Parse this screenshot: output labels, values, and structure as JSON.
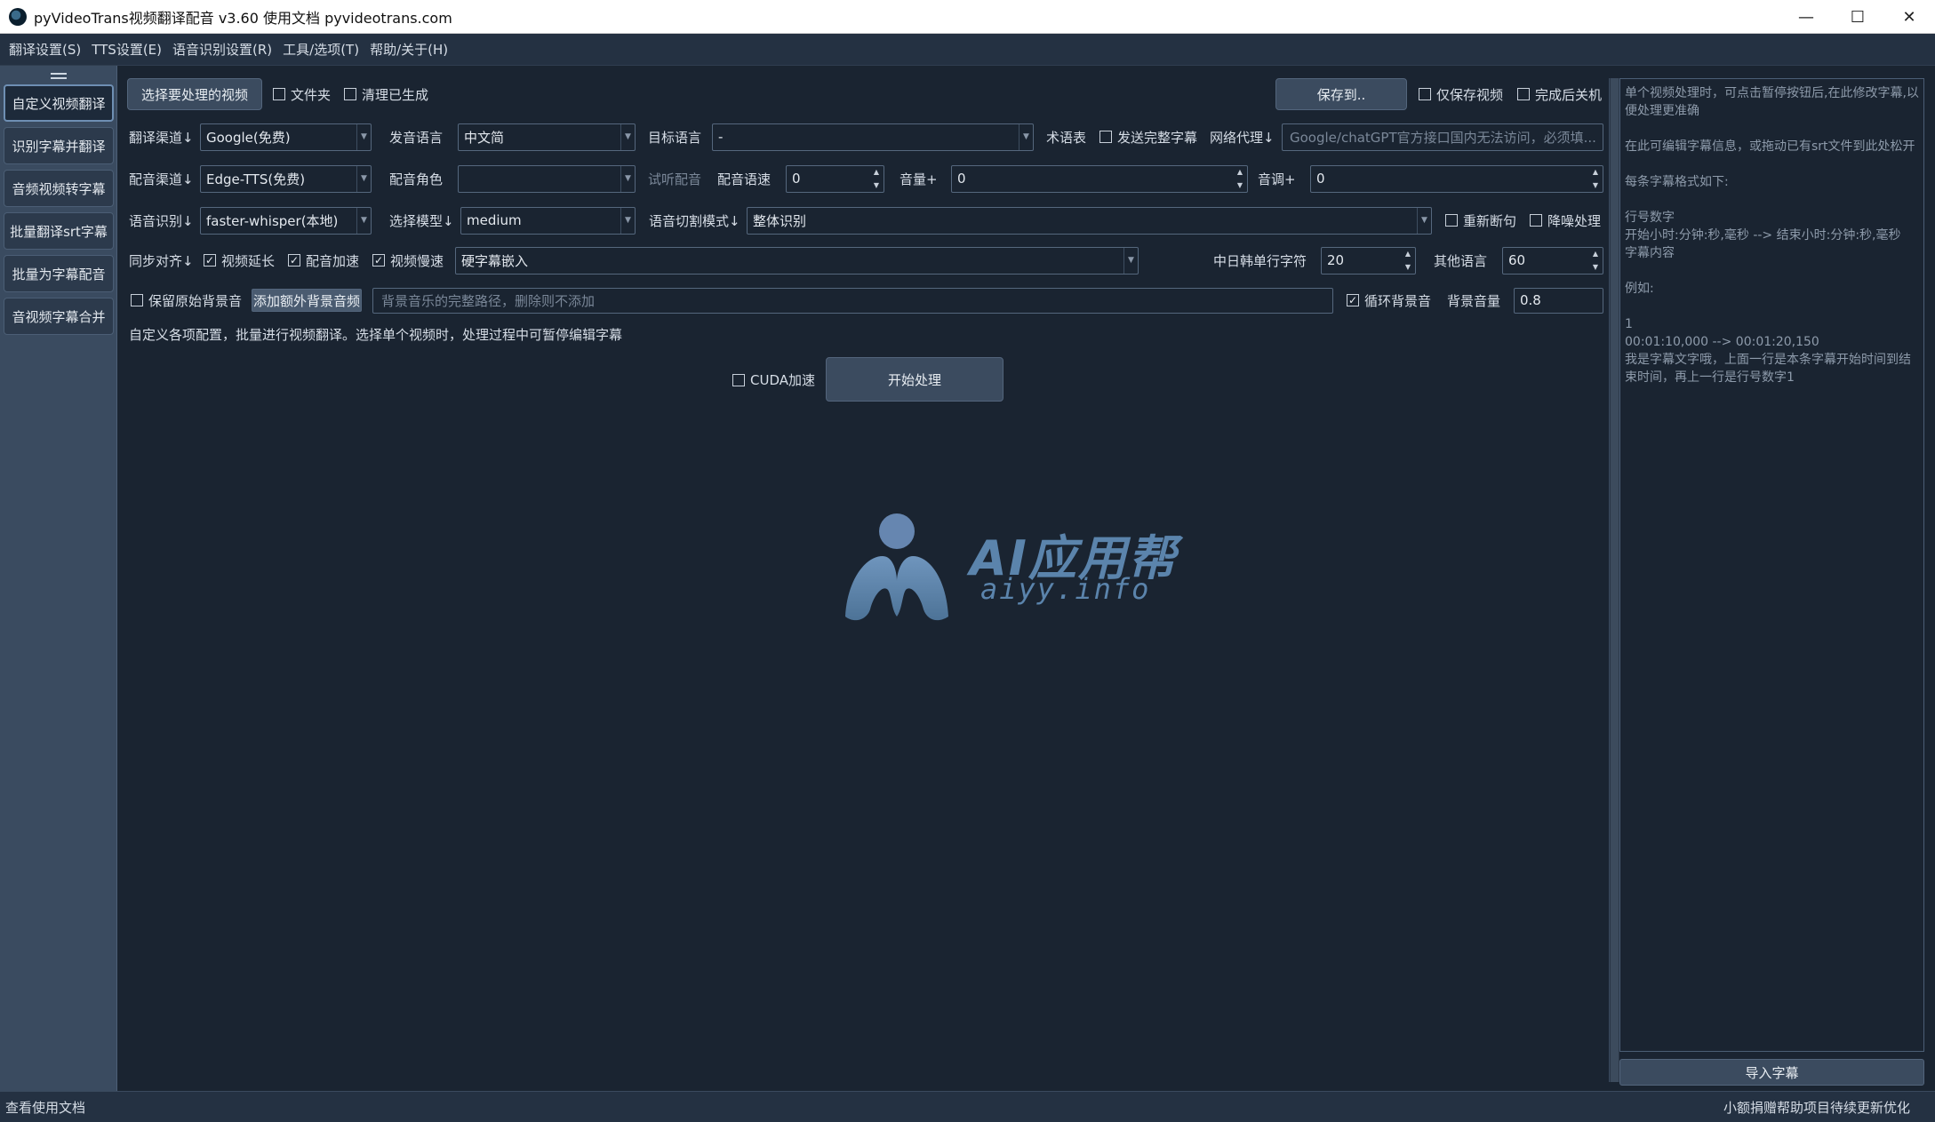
{
  "window": {
    "title": "pyVideoTrans视频翻译配音 v3.60  使用文档  pyvideotrans.com",
    "minimize": "—",
    "maximize": "☐",
    "close": "✕"
  },
  "menu": [
    "翻译设置(S)",
    "TTS设置(E)",
    "语音识别设置(R)",
    "工具/选项(T)",
    "帮助/关于(H)"
  ],
  "sidebar": {
    "items": [
      "自定义视频翻译",
      "识别字幕并翻译",
      "音频视频转字幕",
      "批量翻译srt字幕",
      "批量为字幕配音",
      "音视频字幕合并"
    ]
  },
  "row1": {
    "select_video": "选择要处理的视频",
    "folder": "文件夹",
    "clear_generated": "清理已生成",
    "save_to": "保存到..",
    "only_save_video": "仅保存视频",
    "shutdown_after": "完成后关机"
  },
  "row2": {
    "translate_channel_label": "翻译渠道↓",
    "translate_channel_value": "Google(免费)",
    "source_lang_label": "发音语言",
    "source_lang_value": "中文简",
    "target_lang_label": "目标语言",
    "target_lang_value": "-",
    "glossary_label": "术语表",
    "send_full_subtitle": "发送完整字幕",
    "proxy_label": "网络代理↓",
    "proxy_placeholder": "Google/chatGPT官方接口国内无法访问，必须填..."
  },
  "row3": {
    "dub_channel_label": "配音渠道↓",
    "dub_channel_value": "Edge-TTS(免费)",
    "dub_role_label": "配音角色",
    "dub_role_value": "",
    "preview_dub": "试听配音",
    "dub_speed_label": "配音语速",
    "dub_speed_value": "0",
    "volume_label": "音量+",
    "volume_value": "0",
    "pitch_label": "音调+",
    "pitch_value": "0"
  },
  "row4": {
    "asr_label": "语音识别↓",
    "asr_value": "faster-whisper(本地)",
    "model_label": "选择模型↓",
    "model_value": "medium",
    "split_mode_label": "语音切割模式↓",
    "split_mode_value": "整体识别",
    "resegment": "重新断句",
    "denoise": "降噪处理"
  },
  "row5": {
    "sync_label": "同步对齐↓",
    "video_extend": "视频延长",
    "dub_speedup": "配音加速",
    "video_slowdown": "视频慢速",
    "subtitle_mode_value": "硬字幕嵌入",
    "cjk_chars_label": "中日韩单行字符",
    "cjk_chars_value": "20",
    "other_lang_label": "其他语言",
    "other_lang_value": "60"
  },
  "row6": {
    "keep_bg": "保留原始背景音",
    "add_bg_audio": "添加额外背景音频",
    "bg_path_placeholder": "背景音乐的完整路径，删除则不添加",
    "loop_bg": "循环背景音",
    "bg_volume_label": "背景音量",
    "bg_volume_value": "0.8"
  },
  "info_text": "自定义各项配置，批量进行视频翻译。选择单个视频时，处理过程中可暂停编辑字幕",
  "action": {
    "cuda": "CUDA加速",
    "start": "开始处理"
  },
  "watermark": {
    "title": "AI应用帮",
    "subtitle": "aiyy.info"
  },
  "right_panel": {
    "lines": [
      "单个视频处理时，可点击暂停按钮后,在此修改字幕,以便处理更准确",
      "",
      " 在此可编辑字幕信息，或拖动已有srt文件到此处松开",
      "",
      "每条字幕格式如下:",
      "",
      "行号数字",
      "开始小时:分钟:秒,毫秒 --> 结束小时:分钟:秒,毫秒",
      "字幕内容",
      "",
      "例如:",
      "",
      "1",
      "00:01:10,000 --> 00:01:20,150",
      "我是字幕文字哦，上面一行是本条字幕开始时间到结束时间，再上一行是行号数字1"
    ],
    "import_button": "导入字幕"
  },
  "status": {
    "left": "查看使用文档",
    "right": "小额捐赠帮助项目待续更新优化"
  },
  "checkbox_state": {
    "video_extend": "✓",
    "dub_speedup": "✓",
    "video_slowdown": "✓",
    "loop_bg": "✓"
  },
  "colors": {
    "background": "#1a2431",
    "sidebar": "#3a4b60",
    "button": "#3b4b5f",
    "accent_logo": "#5b84ac"
  }
}
